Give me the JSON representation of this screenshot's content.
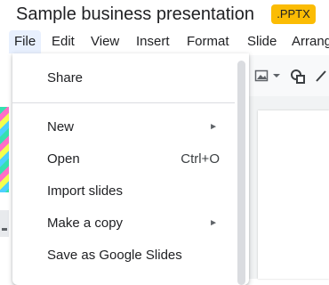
{
  "app": {
    "title": "Sample business presentation",
    "badge": ".PPTX"
  },
  "menubar": {
    "items": [
      {
        "label": "File",
        "active": true
      },
      {
        "label": "Edit"
      },
      {
        "label": "View"
      },
      {
        "label": "Insert"
      },
      {
        "label": "Format"
      },
      {
        "label": "Slide"
      },
      {
        "label": "Arrang"
      }
    ]
  },
  "file_menu": {
    "share": "Share",
    "new": "New",
    "open": "Open",
    "open_shortcut": "Ctrl+O",
    "import_slides": "Import slides",
    "make_copy": "Make a copy",
    "save_as_slides": "Save as Google Slides",
    "submenu_arrow": "►"
  },
  "toolbar": {
    "icons": [
      "image-icon",
      "dropdown-arrow-icon",
      "shapes-icon",
      "line-icon"
    ]
  },
  "colors": {
    "badge": "#fbbc04",
    "menu_active_bg": "#e8f0fe",
    "separator": "#dadce0"
  }
}
